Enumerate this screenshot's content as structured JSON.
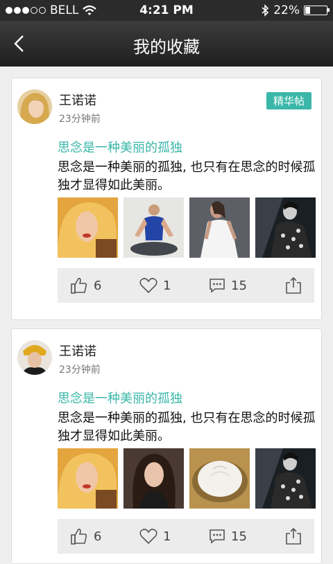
{
  "status": {
    "carrier": "BELL",
    "time": "4:21 PM",
    "battery": "22%",
    "battery_level": 0.22
  },
  "nav": {
    "title": "我的收藏"
  },
  "posts": [
    {
      "user": "王诺诺",
      "time": "23分钟前",
      "badge": "精华帖",
      "title": "思念是一种美丽的孤独",
      "body": "思念是一种美丽的孤独, 也只有在思念的时候孤独才显得如此美丽。",
      "likes": "6",
      "favorites": "1",
      "comments": "15"
    },
    {
      "user": "王诺诺",
      "time": "23分钟前",
      "badge": "",
      "title": "思念是一种美丽的孤独",
      "body": "思念是一种美丽的孤独, 也只有在思念的时候孤独才显得如此美丽。",
      "likes": "6",
      "favorites": "1",
      "comments": "15"
    }
  ],
  "colors": {
    "accent": "#3ab7a8",
    "nav_bg": "#2b2b2b",
    "page_bg": "#efefef"
  },
  "icons": [
    "back-arrow-icon",
    "wifi-icon",
    "bluetooth-icon",
    "battery-icon",
    "thumbs-up-icon",
    "heart-icon",
    "comment-icon",
    "share-icon"
  ]
}
